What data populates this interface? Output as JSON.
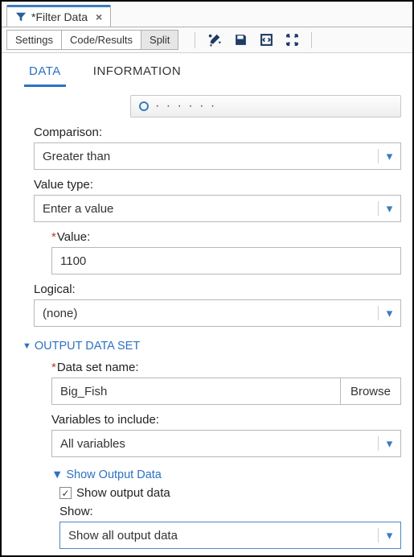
{
  "tab": {
    "title": "*Filter Data"
  },
  "toolbar": {
    "settings": "Settings",
    "codeResults": "Code/Results",
    "split": "Split"
  },
  "subtabs": {
    "data": "DATA",
    "information": "INFORMATION"
  },
  "fields": {
    "comparison": {
      "label": "Comparison:",
      "value": "Greater than"
    },
    "valueType": {
      "label": "Value type:",
      "value": "Enter a value"
    },
    "value": {
      "label": "Value:",
      "value": "1100"
    },
    "logical": {
      "label": "Logical:",
      "value": "(none)"
    }
  },
  "output": {
    "section": "OUTPUT DATA SET",
    "dataSetName": {
      "label": "Data set name:",
      "value": "Big_Fish",
      "browse": "Browse"
    },
    "varsInclude": {
      "label": "Variables to include:",
      "value": "All variables"
    },
    "showSection": "Show Output Data",
    "showCheckbox": "Show output data",
    "show": {
      "label": "Show:",
      "value": "Show all output data"
    }
  }
}
